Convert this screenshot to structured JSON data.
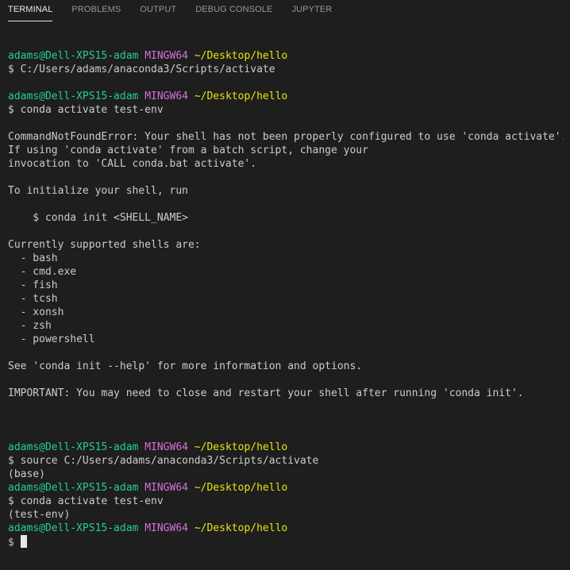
{
  "tabs": [
    {
      "label": "TERMINAL",
      "active": true
    },
    {
      "label": "PROBLEMS",
      "active": false
    },
    {
      "label": "OUTPUT",
      "active": false
    },
    {
      "label": "DEBUG CONSOLE",
      "active": false
    },
    {
      "label": "JUPYTER",
      "active": false
    }
  ],
  "colors": {
    "background": "#1e1e1e",
    "text": "#cccccc",
    "user_host": "#23d18b",
    "system": "#d670d6",
    "path": "#e5e510"
  },
  "prompt": {
    "user_host": "adams@Dell-XPS15-adam",
    "system": "MINGW64",
    "path": "~/Desktop/hello",
    "symbol": "$"
  },
  "lines": [
    {
      "type": "blank"
    },
    {
      "type": "prompt"
    },
    {
      "type": "text",
      "text": "$ C:/Users/adams/anaconda3/Scripts/activate"
    },
    {
      "type": "blank"
    },
    {
      "type": "prompt"
    },
    {
      "type": "text",
      "text": "$ conda activate test-env"
    },
    {
      "type": "blank"
    },
    {
      "type": "text",
      "text": "CommandNotFoundError: Your shell has not been properly configured to use 'conda activate'."
    },
    {
      "type": "text",
      "text": "If using 'conda activate' from a batch script, change your"
    },
    {
      "type": "text",
      "text": "invocation to 'CALL conda.bat activate'."
    },
    {
      "type": "blank"
    },
    {
      "type": "text",
      "text": "To initialize your shell, run"
    },
    {
      "type": "blank"
    },
    {
      "type": "text",
      "text": "    $ conda init <SHELL_NAME>"
    },
    {
      "type": "blank"
    },
    {
      "type": "text",
      "text": "Currently supported shells are:"
    },
    {
      "type": "text",
      "text": "  - bash"
    },
    {
      "type": "text",
      "text": "  - cmd.exe"
    },
    {
      "type": "text",
      "text": "  - fish"
    },
    {
      "type": "text",
      "text": "  - tcsh"
    },
    {
      "type": "text",
      "text": "  - xonsh"
    },
    {
      "type": "text",
      "text": "  - zsh"
    },
    {
      "type": "text",
      "text": "  - powershell"
    },
    {
      "type": "blank"
    },
    {
      "type": "text",
      "text": "See 'conda init --help' for more information and options."
    },
    {
      "type": "blank"
    },
    {
      "type": "text",
      "text": "IMPORTANT: You may need to close and restart your shell after running 'conda init'."
    },
    {
      "type": "blank"
    },
    {
      "type": "blank"
    },
    {
      "type": "blank"
    },
    {
      "type": "prompt"
    },
    {
      "type": "text",
      "text": "$ source C:/Users/adams/anaconda3/Scripts/activate"
    },
    {
      "type": "text",
      "text": "(base)"
    },
    {
      "type": "prompt"
    },
    {
      "type": "text",
      "text": "$ conda activate test-env"
    },
    {
      "type": "text",
      "text": "(test-env)"
    },
    {
      "type": "prompt"
    },
    {
      "type": "cursor"
    }
  ]
}
